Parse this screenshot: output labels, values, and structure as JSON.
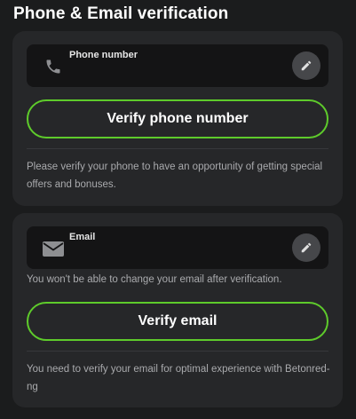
{
  "page": {
    "title": "Phone & Email verification"
  },
  "phone": {
    "field_label": "Phone number",
    "verify_label": "Verify phone number",
    "note": "Please verify your phone to have an opportunity of getting special offers and bonuses."
  },
  "email": {
    "field_label": "Email",
    "warning": "You won't be able to change your email after verification.",
    "verify_label": "Verify email",
    "note": "You need to verify your email for optimal experience with Betonred-ng"
  },
  "colors": {
    "accent": "#5ecb2b",
    "background": "#1b1c1d",
    "card": "#262729",
    "field": "#141415"
  },
  "icons": {
    "phone": "phone-icon",
    "email": "envelope-icon",
    "edit": "pencil-icon"
  }
}
